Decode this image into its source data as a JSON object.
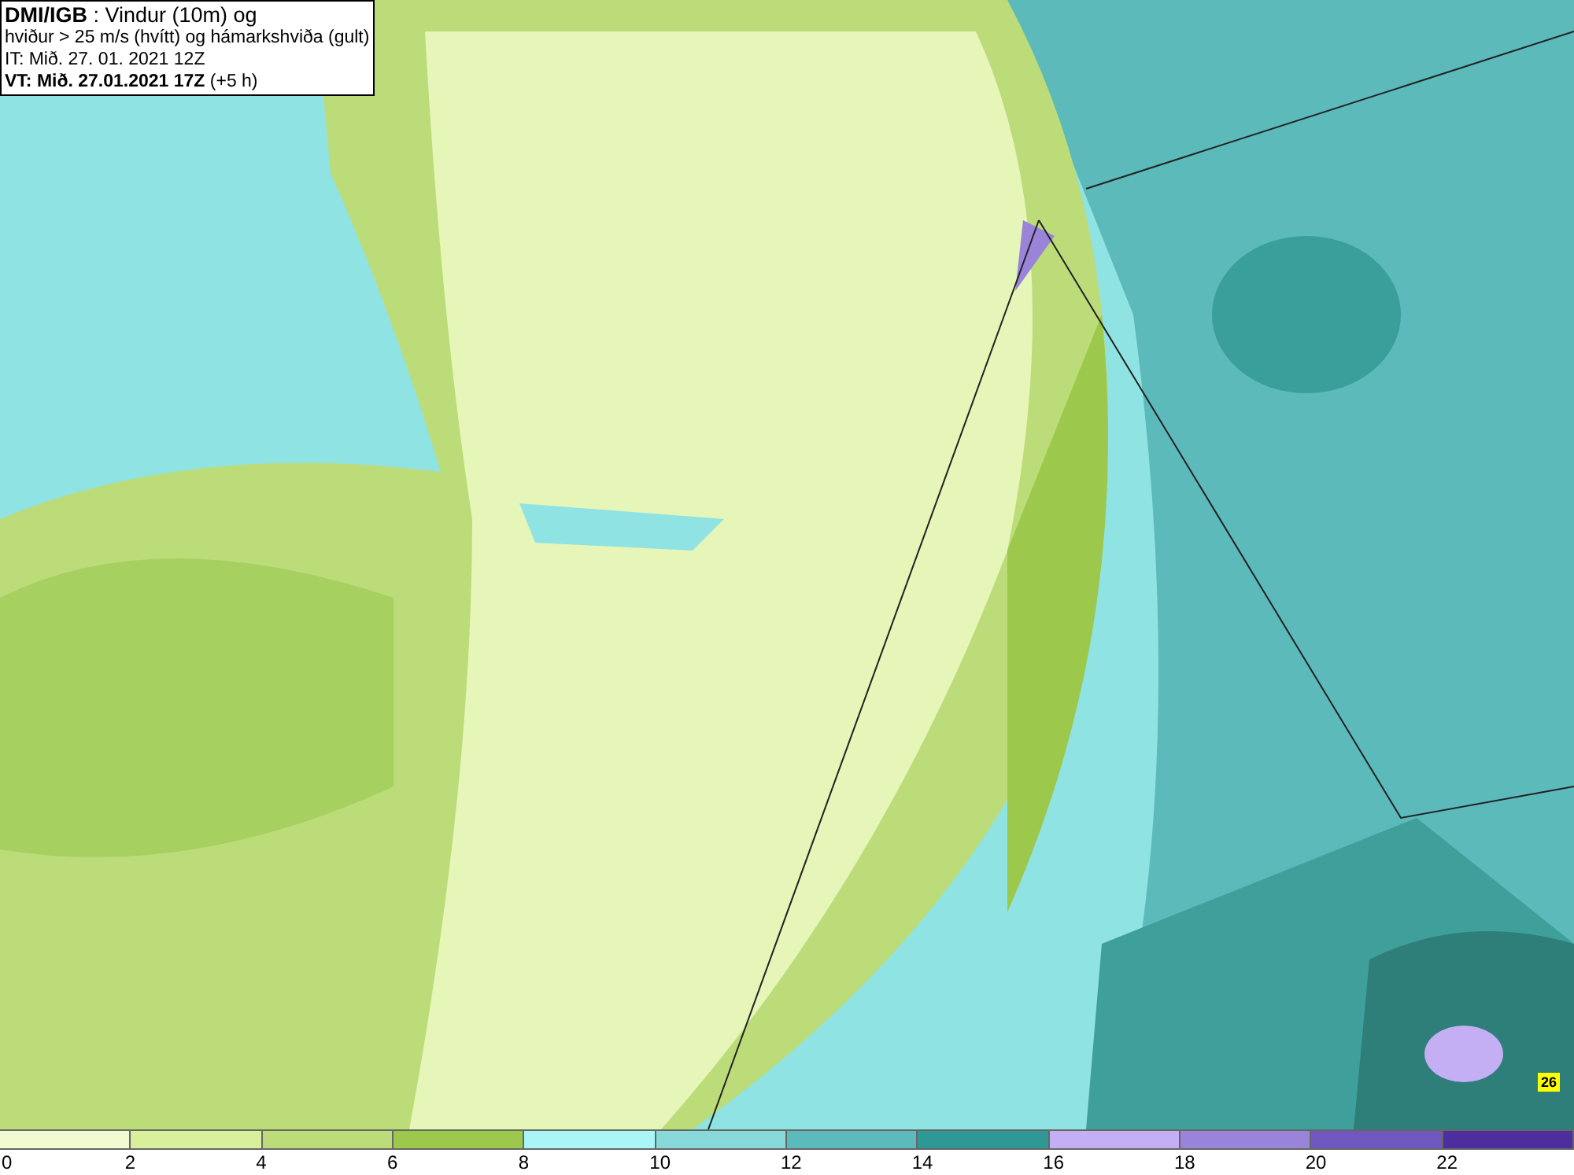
{
  "header": {
    "lines": [
      "**DMI/IGB** : Vindur (10m) og",
      "hviður > 25 m/s (hvítt) og hámarkshviða (gult)",
      "IT: Mið. 27. 01. 2021 12Z",
      "**VT: Mið. 27.01.2021 17Z** (+5 h)"
    ]
  },
  "map": {
    "max_gust_badge": "26"
  },
  "legend": [
    {
      "label": "0",
      "color": "#f2fad2"
    },
    {
      "label": "2",
      "color": "#d8f09c"
    },
    {
      "label": "4",
      "color": "#bcdc7a"
    },
    {
      "label": "6",
      "color": "#9cc84c"
    },
    {
      "label": "8",
      "color": "#aaf6f6"
    },
    {
      "label": "10",
      "color": "#88dada"
    },
    {
      "label": "12",
      "color": "#5cbaba"
    },
    {
      "label": "14",
      "color": "#2e9894"
    },
    {
      "label": "16",
      "color": "#c4aef4"
    },
    {
      "label": "18",
      "color": "#9a84da"
    },
    {
      "label": "20",
      "color": "#7058c0"
    },
    {
      "label": "22",
      "color": "#4e2e9e"
    }
  ]
}
